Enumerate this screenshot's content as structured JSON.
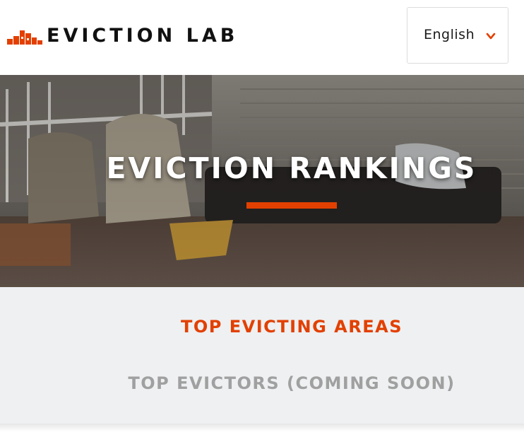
{
  "header": {
    "logo_text": "EVICTION LAB",
    "language_selected": "English"
  },
  "hero": {
    "title": "EVICTION RANKINGS"
  },
  "tabs": [
    {
      "label": "TOP EVICTING AREAS",
      "active": true
    },
    {
      "label": "TOP EVICTORS (COMING SOON)",
      "active": false
    }
  ],
  "colors": {
    "accent": "#e24000",
    "tabs_background": "#eef0f2",
    "inactive_tab": "#a0a0a0"
  },
  "icons": {
    "logo": "eviction-lab-logo-icon",
    "dropdown": "chevron-down-icon"
  }
}
